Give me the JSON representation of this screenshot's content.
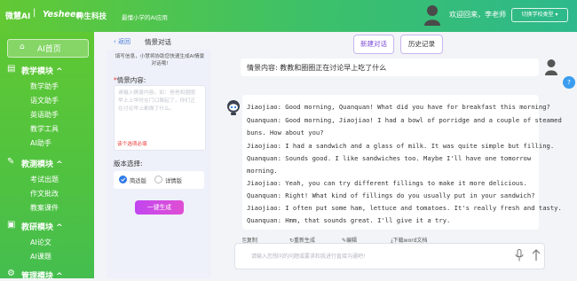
{
  "header": {
    "brand_main": "微慧AI",
    "brand_logo": "Yesheen",
    "brand_logo_cn": "粹生科技",
    "tagline": "最懂小学的AI应用",
    "welcome": "欢迎回来，李老师",
    "switch_label": "切换学校类型"
  },
  "sidebar": {
    "home": "AI首页",
    "sections": [
      {
        "label": "教学模块",
        "items": [
          "数学助手",
          "语文助手",
          "英语助手",
          "教学工具",
          "AI助手"
        ]
      },
      {
        "label": "教测模块",
        "items": [
          "考试出题",
          "作文批改",
          "教案课件"
        ]
      },
      {
        "label": "教研模块",
        "items": [
          "AI论文",
          "AI课题"
        ]
      },
      {
        "label": "管理模块",
        "items": []
      }
    ]
  },
  "form": {
    "back": "返回",
    "title": "情景对话",
    "tip": "填写信息，小慧将协助您快速生成AI情景对话哦!",
    "content_label": "情景内容:",
    "placeholder": "请输入情景内容。如：爸爸和圈圈早上上学时在门口聊起了，你们正在讨论早上都做了什么。",
    "warning": "该个选项必填",
    "version_label": "版本选择:",
    "option_simple": "简适版",
    "option_detail": "详情版",
    "generate": "一键生成"
  },
  "toolbar": {
    "new_chat": "新建对话",
    "history": "历史记录"
  },
  "chat": {
    "question": "情景内容: 教教和圈圈正在讨论早上吃了什么",
    "answer_lines": [
      "Jiaojiao: Good morning, Quanquan! What did you have for breakfast this morning?",
      "Quanquan: Good morning, Jiaojiao! I had a bowl of porridge and a couple of steamed",
      "buns. How about you?",
      "Jiaojiao: I had a sandwich and a glass of milk. It was quite simple but filling.",
      "Quanquan: Sounds good. I like sandwiches too. Maybe I'll have one tomorrow",
      "morning.",
      "Jiaojiao: Yeah, you can try different fillings to make it more delicious.",
      "Quanquan: Right! What kind of fillings do you usually put in your sandwich?",
      "Jiaojiao: I often put some ham, lettuce and tomatoes. It's really fresh and tasty.",
      "Quanquan: Hmm, that sounds great. I'll give it a try."
    ],
    "actions": [
      "复制",
      "重新生成",
      "编辑",
      "下载word文档"
    ],
    "input_placeholder": "请输入您想问的问题或要求和我进行直接沟通吧!",
    "help_label": "?"
  },
  "colors": {
    "green_start": "#62c934",
    "green_end": "#2db98c",
    "purple": "#c146f0",
    "blue": "#2f7be5"
  }
}
